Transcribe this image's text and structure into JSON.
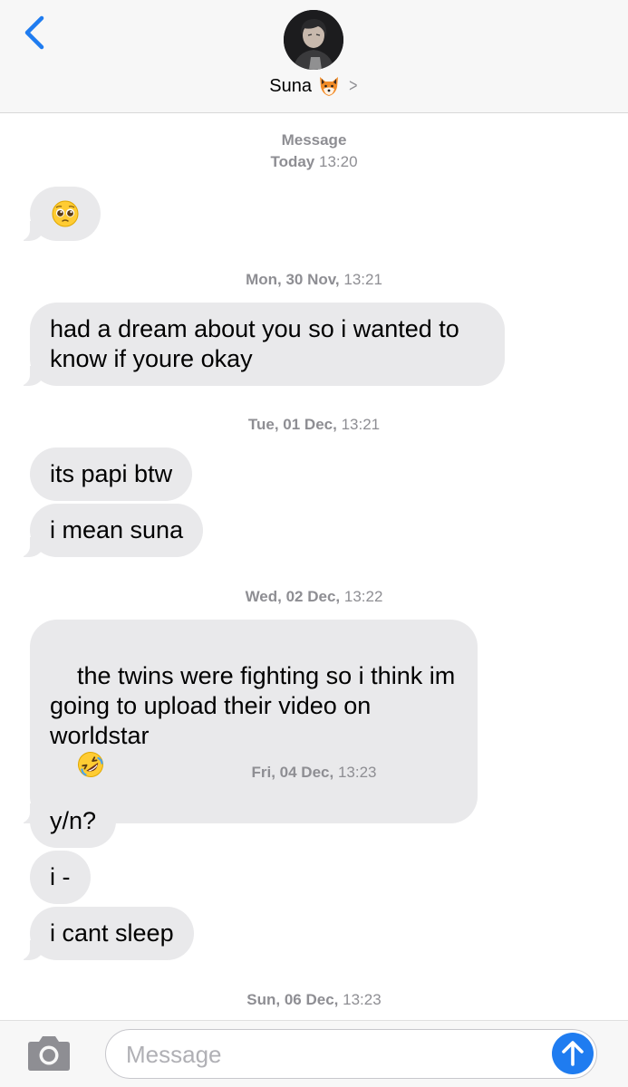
{
  "header": {
    "back_icon": "chevron-left-icon",
    "contact_name": "Suna",
    "contact_emoji_icon": "fox-face-icon",
    "chevron_icon": "chevron-right-icon",
    "chevron_glyph": ">"
  },
  "conversation": [
    {
      "label_bold": "Message",
      "time_bold": "Today",
      "time": "13:20"
    },
    {
      "emoji_icon": "pleading-face-icon"
    },
    {
      "day_bold": "Mon, 30 Nov,",
      "time": "13:21"
    },
    {
      "text": "had a dream about you so i wanted to\nknow if youre okay"
    },
    {
      "day_bold": "Tue, 01 Dec,",
      "time": "13:21"
    },
    {
      "text": "its papi btw"
    },
    {
      "text": "i mean suna"
    },
    {
      "day_bold": "Wed, 02 Dec,",
      "time": "13:22"
    },
    {
      "text": "the twins were fighting so i think im\ngoing to upload their video on\nworldstar",
      "emoji_icon": "rolling-on-floor-laughing-icon"
    },
    {
      "day_bold": "Fri, 04 Dec,",
      "time": "13:23"
    },
    {
      "text": "y/n?"
    },
    {
      "text": "i -"
    },
    {
      "text": "i cant sleep"
    },
    {
      "day_bold": "Sun, 06 Dec,",
      "time": "13:23"
    }
  ],
  "input_bar": {
    "camera_icon": "camera-icon",
    "placeholder": "Message",
    "value": "",
    "send_icon": "arrow-up-icon"
  },
  "colors": {
    "accent": "#1f7cf0",
    "bubble_gray": "#e9e9eb",
    "timestamp_gray": "#8e8e93"
  }
}
